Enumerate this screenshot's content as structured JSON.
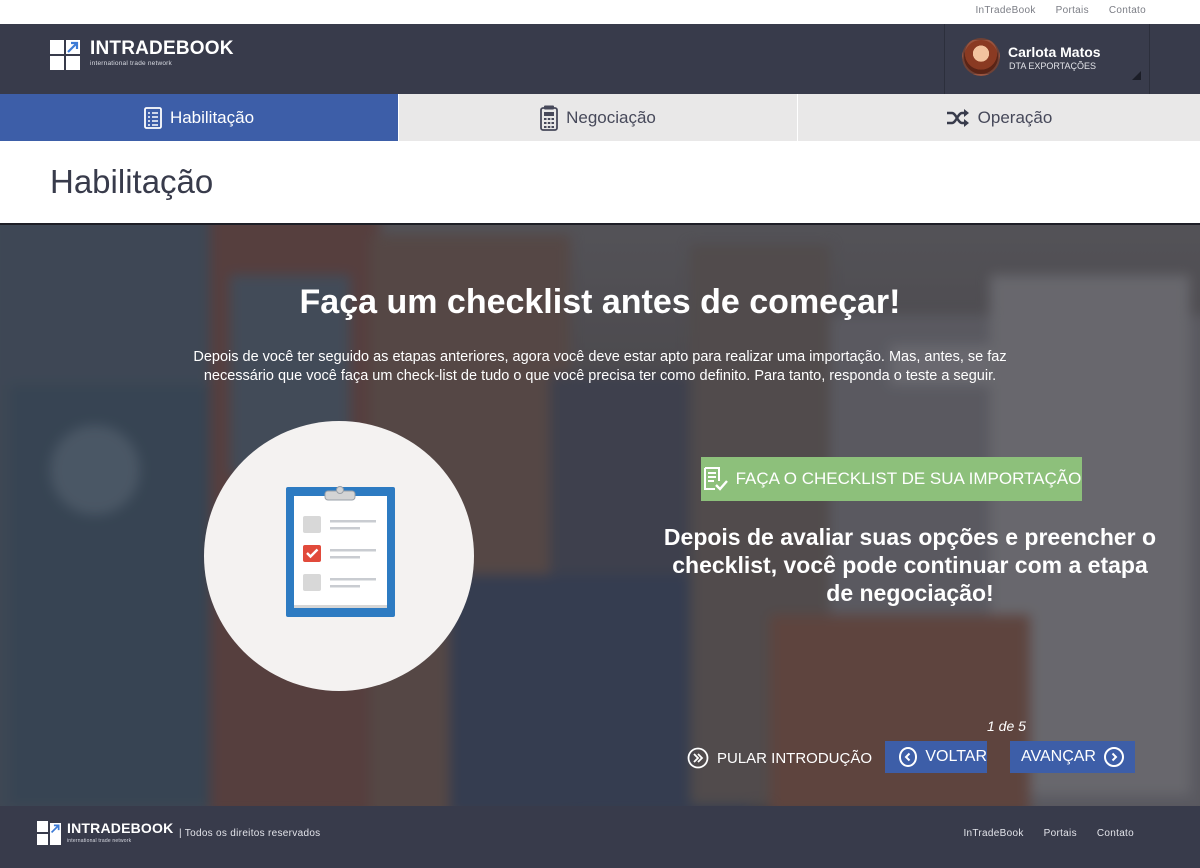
{
  "top_links": [
    "InTradeBook",
    "Portais",
    "Contato"
  ],
  "logo": {
    "brand": "INTRADEBOOK",
    "tagline": "international trade network"
  },
  "user": {
    "name": "Carlota Matos",
    "company": "DTA EXPORTAÇÕES"
  },
  "tabs": [
    {
      "label": "Habilitação",
      "icon": "checklist-icon",
      "active": true
    },
    {
      "label": "Negociação",
      "icon": "calculator-icon",
      "active": false
    },
    {
      "label": "Operação",
      "icon": "shuffle-icon",
      "active": false
    }
  ],
  "page_title": "Habilitação",
  "hero": {
    "heading": "Faça um checklist antes de começar!",
    "intro": "Depois de você ter seguido as etapas anteriores, agora você deve estar apto para realizar uma importação. Mas, antes, se faz necessário que você faça um check-list de tudo o que você precisa ter como definito. Para tanto, responda o teste a seguir.",
    "cta_label": "FAÇA O CHECKLIST DE SUA IMPORTAÇÃO",
    "message": "Depois de avaliar suas opções e preencher o checklist, você pode continuar com a etapa de negociação!",
    "pager": "1 de 5",
    "skip_label": "PULAR INTRODUÇÃO",
    "back_label": "VOLTAR",
    "next_label": "AVANÇAR"
  },
  "footer": {
    "rights": "Todos os direitos reservados",
    "links": [
      "InTradeBook",
      "Portais",
      "Contato"
    ]
  },
  "colors": {
    "header_bg": "#383b4b",
    "accent_blue": "#3d5ea8",
    "cta_green": "#8dc07b",
    "tab_bg": "#e9e8e8"
  }
}
